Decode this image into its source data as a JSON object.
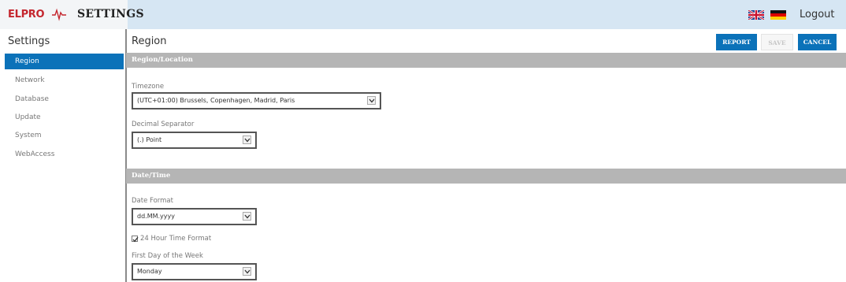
{
  "header": {
    "logo_text": "ELPRO",
    "title": "SETTINGS",
    "languages": [
      "English",
      "Deutsch"
    ],
    "logout_label": "Logout"
  },
  "sidebar": {
    "title": "Settings",
    "items": [
      {
        "label": "Region",
        "active": true
      },
      {
        "label": "Network",
        "active": false
      },
      {
        "label": "Database",
        "active": false
      },
      {
        "label": "Update",
        "active": false
      },
      {
        "label": "System",
        "active": false
      },
      {
        "label": "WebAccess",
        "active": false
      }
    ]
  },
  "main": {
    "page_title": "Region",
    "buttons": {
      "report": "REPORT",
      "save": "SAVE",
      "cancel": "CANCEL"
    },
    "sections": {
      "region": {
        "title": "Region/Location",
        "timezone": {
          "label": "Timezone",
          "value": "(UTC+01:00) Brussels, Copenhagen, Madrid, Paris"
        },
        "decimal_separator": {
          "label": "Decimal Separator",
          "value": "(.) Point"
        }
      },
      "datetime": {
        "title": "Date/Time",
        "date_format": {
          "label": "Date Format",
          "value": "dd.MM.yyyy"
        },
        "time_format": {
          "label": "24 Hour Time Format",
          "checked": true
        },
        "first_day": {
          "label": "First Day of the Week",
          "value": "Monday"
        }
      }
    }
  },
  "colors": {
    "accent": "#0b72b9",
    "topbar": "#d6e6f3",
    "section_header": "#b5b5b5",
    "logo": "#c4262e"
  }
}
